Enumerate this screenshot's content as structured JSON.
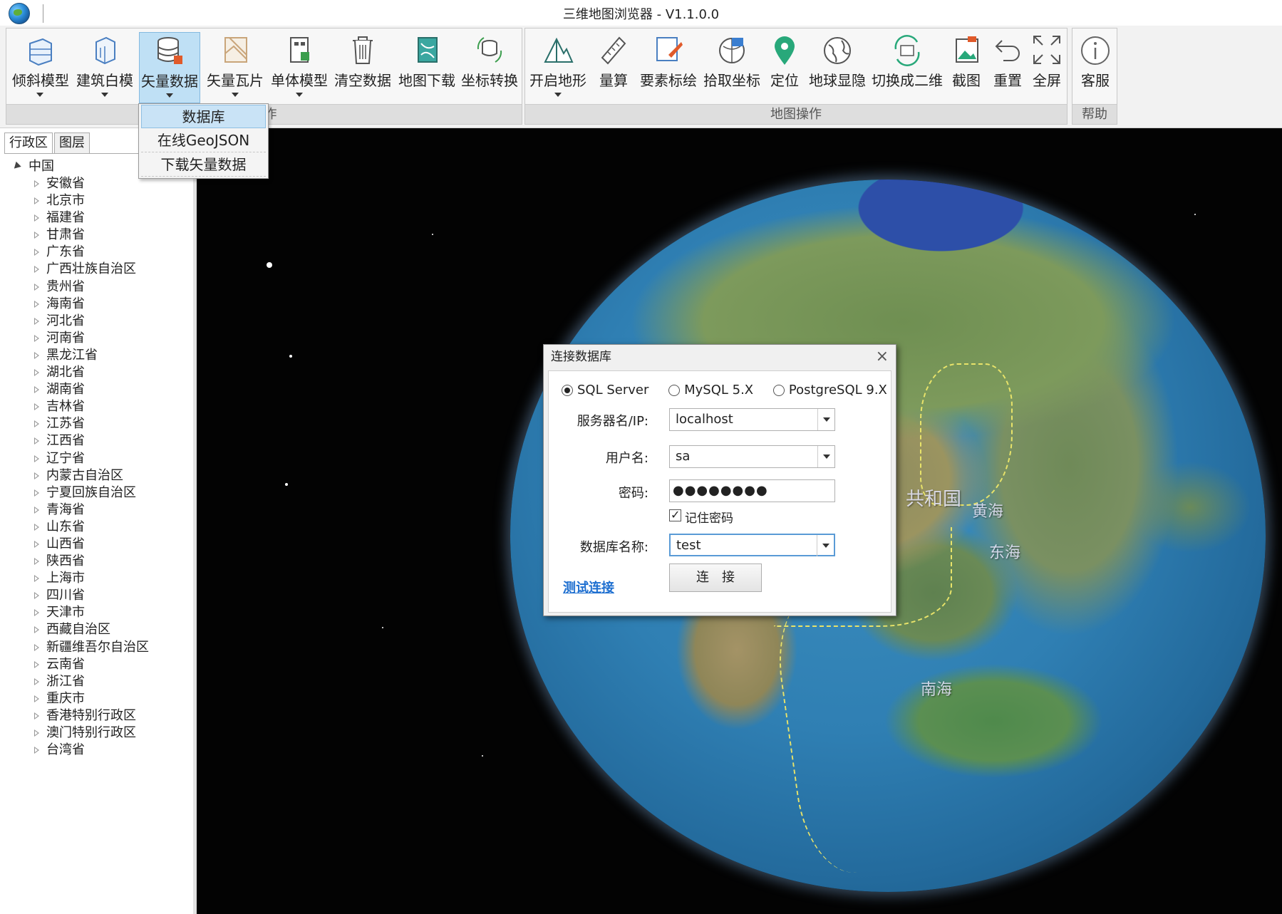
{
  "window": {
    "title": "三维地图浏览器 - V1.1.0.0"
  },
  "ribbon": {
    "group1": {
      "label": "操作",
      "buttons": [
        {
          "label": "倾斜模型",
          "icon": "tilt-model-icon"
        },
        {
          "label": "建筑白模",
          "icon": "building-model-icon"
        },
        {
          "label": "矢量数据",
          "icon": "vector-database-icon"
        },
        {
          "label": "矢量瓦片",
          "icon": "vector-tile-icon"
        },
        {
          "label": "单体模型",
          "icon": "single-model-icon"
        },
        {
          "label": "清空数据",
          "icon": "trash-icon"
        },
        {
          "label": "地图下载",
          "icon": "map-download-icon"
        },
        {
          "label": "坐标转换",
          "icon": "coordinate-convert-icon"
        }
      ]
    },
    "group2": {
      "label": "地图操作",
      "buttons": [
        {
          "label": "开启地形",
          "icon": "terrain-icon"
        },
        {
          "label": "量算",
          "icon": "ruler-icon"
        },
        {
          "label": "要素标绘",
          "icon": "plot-icon"
        },
        {
          "label": "拾取坐标",
          "icon": "pick-coordinate-icon"
        },
        {
          "label": "定位",
          "icon": "location-pin-icon"
        },
        {
          "label": "地球显隐",
          "icon": "globe-toggle-icon"
        },
        {
          "label": "切换成二维",
          "icon": "switch-2d-icon"
        },
        {
          "label": "截图",
          "icon": "screenshot-icon"
        },
        {
          "label": "重置",
          "icon": "undo-icon"
        },
        {
          "label": "全屏",
          "icon": "fullscreen-icon"
        }
      ]
    },
    "group3": {
      "label": "帮助",
      "buttons": [
        {
          "label": "客服",
          "icon": "info-icon"
        }
      ]
    }
  },
  "dropdown": {
    "items": [
      "数据库",
      "在线GeoJSON",
      "下载矢量数据"
    ],
    "selected": "数据库"
  },
  "leftpanel": {
    "tabs": [
      "行政区",
      "图层"
    ],
    "active_tab": "行政区",
    "root": "中国",
    "provinces": [
      "安徽省",
      "北京市",
      "福建省",
      "甘肃省",
      "广东省",
      "广西壮族自治区",
      "贵州省",
      "海南省",
      "河北省",
      "河南省",
      "黑龙江省",
      "湖北省",
      "湖南省",
      "吉林省",
      "江苏省",
      "江西省",
      "辽宁省",
      "内蒙古自治区",
      "宁夏回族自治区",
      "青海省",
      "山东省",
      "山西省",
      "陕西省",
      "上海市",
      "四川省",
      "天津市",
      "西藏自治区",
      "新疆维吾尔自治区",
      "云南省",
      "浙江省",
      "重庆市",
      "香港特别行政区",
      "澳门特别行政区",
      "台湾省"
    ]
  },
  "map": {
    "labels": [
      "共和国",
      "黄海",
      "东海",
      "南海"
    ]
  },
  "dialog": {
    "title": "连接数据库",
    "close": "×",
    "db_types": [
      "SQL Server",
      "MySQL 5.X",
      "PostgreSQL 9.X"
    ],
    "selected_db_type": "SQL Server",
    "server_label": "服务器名/IP:",
    "server_value": "localhost",
    "user_label": "用户名:",
    "user_value": "sa",
    "password_label": "密码:",
    "password_value": "●●●●●●●●",
    "remember_label": "记住密码",
    "remember_checked": true,
    "dbname_label": "数据库名称:",
    "dbname_value": "test",
    "test_link": "测试连接",
    "connect_button": "连　接"
  }
}
